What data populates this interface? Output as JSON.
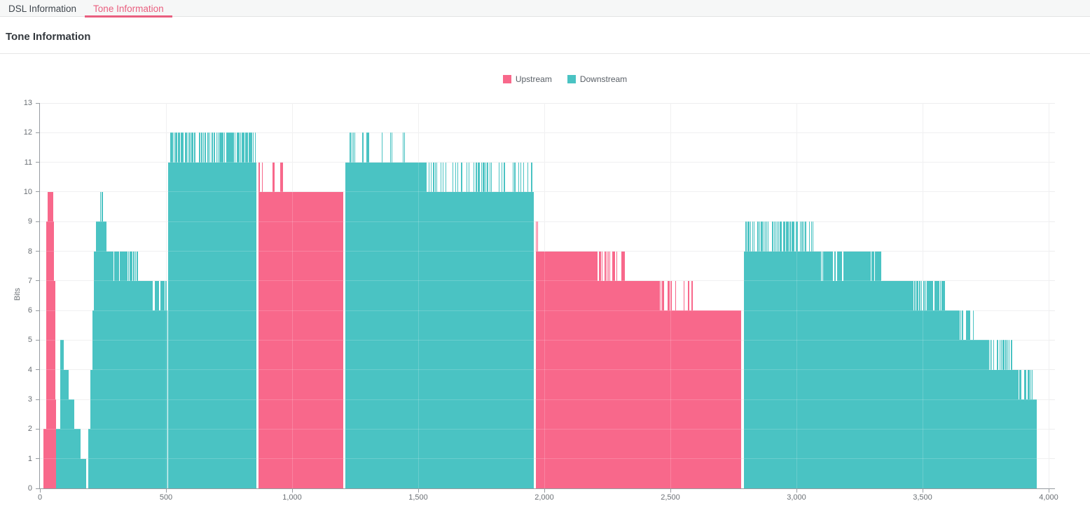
{
  "tabs": [
    {
      "label": "DSL Information",
      "active": false
    },
    {
      "label": "Tone Information",
      "active": true
    }
  ],
  "page": {
    "title": "Tone Information"
  },
  "colors": {
    "active_tab": "#e95f7f",
    "upstream": "#f8688b",
    "downstream": "#4ac3c3",
    "grid": "#ededee",
    "axis_text": "#6b7075",
    "axis_line": "#969ba0"
  },
  "chart_data": {
    "type": "bar",
    "title": "",
    "xlabel": "",
    "ylabel": "Bits",
    "ylim": [
      0,
      13
    ],
    "xlim": [
      0,
      4000
    ],
    "grid": true,
    "legend_position": "top-center",
    "yticks": [
      0,
      1,
      2,
      3,
      4,
      5,
      6,
      7,
      8,
      9,
      10,
      11,
      12,
      13
    ],
    "xticks": [
      {
        "v": 0,
        "label": "0"
      },
      {
        "v": 500,
        "label": "500"
      },
      {
        "v": 1000,
        "label": "1,000"
      },
      {
        "v": 1500,
        "label": "1,500"
      },
      {
        "v": 2000,
        "label": "2,000"
      },
      {
        "v": 2500,
        "label": "2,500"
      },
      {
        "v": 3000,
        "label": "3,000"
      },
      {
        "v": 3500,
        "label": "3,500"
      },
      {
        "v": 4000,
        "label": "4,000"
      }
    ],
    "series": [
      {
        "name": "Upstream",
        "color": "#f8688b",
        "segments": [
          [
            14,
            26,
            2
          ],
          [
            26,
            30,
            9
          ],
          [
            30,
            52,
            10
          ],
          [
            52,
            56,
            9
          ],
          [
            56,
            61,
            7
          ],
          [
            61,
            64,
            3
          ],
          [
            866,
            1204,
            10
          ],
          [
            1967,
            2212,
            8
          ],
          [
            2212,
            2458,
            7
          ],
          [
            2458,
            2781,
            6
          ]
        ]
      },
      {
        "name": "Downstream",
        "color": "#4ac3c3",
        "segments": [
          [
            63,
            80,
            2
          ],
          [
            80,
            95,
            5
          ],
          [
            95,
            113,
            4
          ],
          [
            113,
            135,
            3
          ],
          [
            135,
            161,
            2
          ],
          [
            161,
            183,
            1
          ],
          [
            192,
            201,
            2
          ],
          [
            201,
            208,
            4
          ],
          [
            208,
            215,
            6
          ],
          [
            215,
            222,
            8
          ],
          [
            222,
            264,
            9
          ],
          [
            264,
            389,
            8
          ],
          [
            389,
            506,
            7
          ],
          [
            508,
            858,
            11
          ],
          [
            1211,
            1532,
            11
          ],
          [
            1532,
            1958,
            10
          ],
          [
            2792,
            3340,
            8
          ],
          [
            3340,
            3592,
            7
          ],
          [
            3592,
            3706,
            6
          ],
          [
            3706,
            3856,
            5
          ],
          [
            3856,
            3936,
            4
          ],
          [
            3936,
            3954,
            3
          ]
        ]
      }
    ],
    "noise": [
      {
        "series": "Upstream",
        "tones": [
          866,
          884
        ],
        "from": 10,
        "to": 11,
        "density": 0.4
      },
      {
        "series": "Upstream",
        "tones": [
          921,
          927
        ],
        "from": 10,
        "to": 11,
        "density": 0.7
      },
      {
        "series": "Upstream",
        "tones": [
          954,
          960
        ],
        "from": 10,
        "to": 11,
        "density": 0.7
      },
      {
        "series": "Upstream",
        "tones": [
          1967,
          1973
        ],
        "from": 8,
        "to": 9,
        "density": 0.6
      },
      {
        "series": "Upstream",
        "tones": [
          2212,
          2318
        ],
        "from": 7,
        "to": 8,
        "density": 0.3
      },
      {
        "series": "Upstream",
        "tones": [
          2462,
          2606
        ],
        "from": 6,
        "to": 7,
        "density": 0.3
      },
      {
        "series": "Downstream",
        "tones": [
          232,
          252
        ],
        "from": 9,
        "to": 10,
        "density": 0.3
      },
      {
        "series": "Downstream",
        "tones": [
          287,
          388
        ],
        "from": 8,
        "to": 7,
        "density": 0.2
      },
      {
        "series": "Downstream",
        "tones": [
          448,
          504
        ],
        "from": 7,
        "to": 6,
        "density": 0.25
      },
      {
        "series": "Downstream",
        "tones": [
          517,
          852
        ],
        "from": 11,
        "to": 12,
        "density": 0.62
      },
      {
        "series": "Downstream",
        "tones": [
          1220,
          1302
        ],
        "from": 11,
        "to": 12,
        "density": 0.35
      },
      {
        "series": "Downstream",
        "tones": [
          1356,
          1444
        ],
        "from": 11,
        "to": 12,
        "density": 0.1
      },
      {
        "series": "Downstream",
        "tones": [
          1542,
          1812
        ],
        "from": 10,
        "to": 11,
        "density": 0.32
      },
      {
        "series": "Downstream",
        "tones": [
          1812,
          1950
        ],
        "from": 10,
        "to": 11,
        "density": 0.18
      },
      {
        "series": "Downstream",
        "tones": [
          2798,
          3066
        ],
        "from": 8,
        "to": 9,
        "density": 0.5
      },
      {
        "series": "Downstream",
        "tones": [
          3080,
          3336
        ],
        "from": 8,
        "to": 7,
        "density": 0.15
      },
      {
        "series": "Downstream",
        "tones": [
          3458,
          3590
        ],
        "from": 7,
        "to": 6,
        "density": 0.3
      },
      {
        "series": "Downstream",
        "tones": [
          3648,
          3704
        ],
        "from": 6,
        "to": 5,
        "density": 0.45
      },
      {
        "series": "Downstream",
        "tones": [
          3762,
          3854
        ],
        "from": 5,
        "to": 4,
        "density": 0.45
      },
      {
        "series": "Downstream",
        "tones": [
          3880,
          3934
        ],
        "from": 4,
        "to": 3,
        "density": 0.45
      }
    ]
  }
}
